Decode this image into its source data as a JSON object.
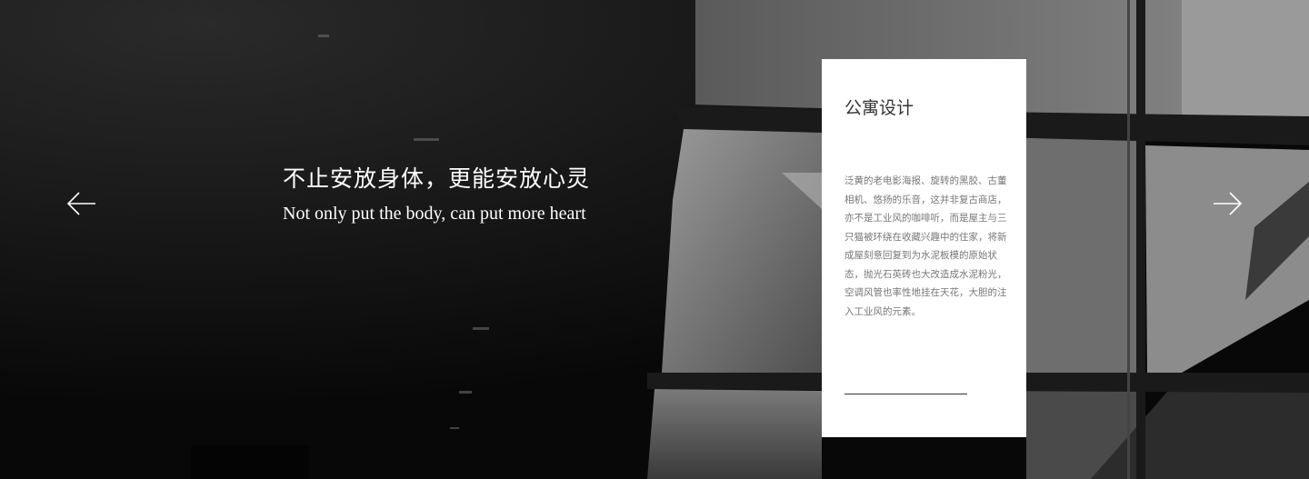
{
  "hero": {
    "slogan_cn": "不止安放身体，更能安放心灵",
    "slogan_en": "Not only put the body, can put more heart",
    "prev_icon": "arrow-left-icon",
    "next_icon": "arrow-right-icon"
  },
  "card": {
    "title": "公寓设计",
    "description": "泛黄的老电影海报、旋转的黑胶、古董相机、悠扬的乐音，这并非复古商店，亦不是工业风的咖啡听，而是屋主与三只猫被环绕在收藏兴趣中的住家，将新成屋刻意回复到为水泥板模的原始状态，抛光石英砖也大改造成水泥粉光，空调风管也率性地挂在天花，大胆的注入工业风的元素。"
  },
  "colors": {
    "card_bg": "#ffffff",
    "text_light": "#ffffff",
    "card_text": "#777777"
  }
}
